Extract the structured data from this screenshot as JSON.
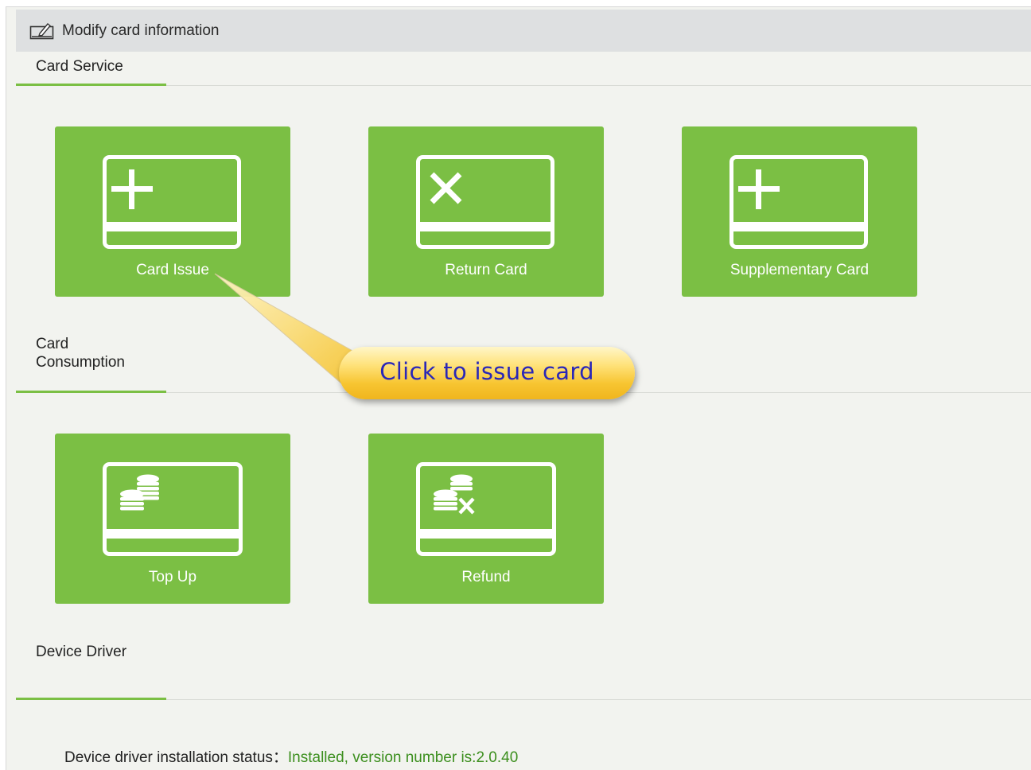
{
  "header": {
    "title": "Modify card information",
    "icon": "edit-icon"
  },
  "sections": {
    "card_service": {
      "title": "Card Service"
    },
    "card_consumption": {
      "title_line1": "Card",
      "title_line2": "Consumption"
    },
    "device_driver": {
      "title": "Device Driver"
    }
  },
  "tiles": {
    "card_issue": {
      "label": "Card Issue",
      "icon": "card-plus-icon"
    },
    "return_card": {
      "label": "Return Card",
      "icon": "card-x-icon"
    },
    "supplementary_card": {
      "label": "Supplementary Card",
      "icon": "card-plus-icon"
    },
    "top_up": {
      "label": "Top Up",
      "icon": "card-coins-icon"
    },
    "refund": {
      "label": "Refund",
      "icon": "card-coins-x-icon"
    }
  },
  "callout": {
    "text": "Click to issue card"
  },
  "status": {
    "label": "Device driver installation status：",
    "value": "Installed, version number is:2.0.40"
  },
  "colors": {
    "tile_green": "#7bbf44",
    "header_bg": "#dee0e1",
    "page_bg": "#f2f3ef",
    "callout_text": "#2a27b8",
    "status_value": "#3c8f1e"
  }
}
